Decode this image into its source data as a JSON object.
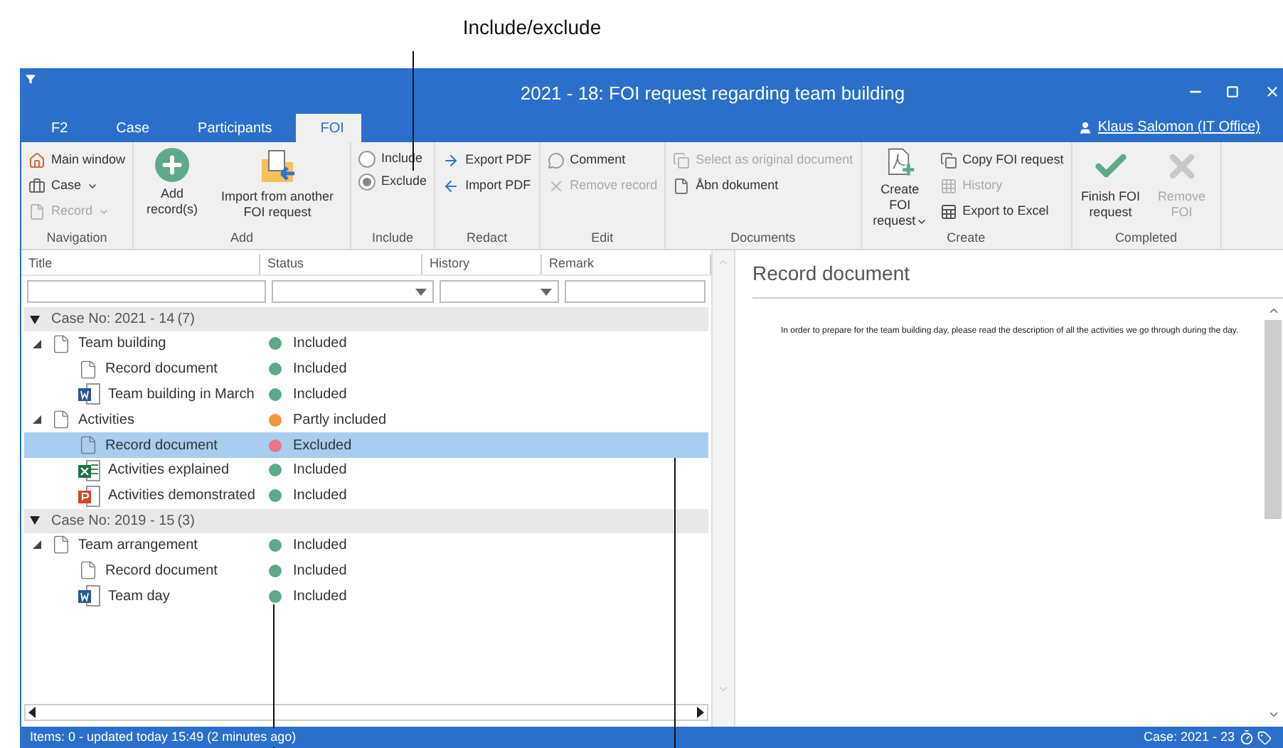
{
  "callout": {
    "label": "Include/exclude"
  },
  "window": {
    "title": "2021 - 18: FOI request regarding team building",
    "user": "Klaus Salomon (IT Office)"
  },
  "tabs": [
    {
      "label": "F2",
      "selected": false
    },
    {
      "label": "Case",
      "selected": false
    },
    {
      "label": "Participants",
      "selected": false
    },
    {
      "label": "FOI",
      "selected": true
    }
  ],
  "ribbon": [
    {
      "label": "Navigation",
      "items": [
        {
          "kind": "small",
          "label": "Main window",
          "disabled": false
        },
        {
          "kind": "small",
          "label": "Case",
          "caret": true,
          "disabled": false
        },
        {
          "kind": "small",
          "label": "Record",
          "caret": true,
          "disabled": true
        }
      ]
    },
    {
      "label": "Add",
      "items": [
        {
          "kind": "large",
          "label": "Add record(s)",
          "disabled": false
        },
        {
          "kind": "large",
          "label": "Import from another FOI request",
          "disabled": false
        }
      ]
    },
    {
      "label": "Include",
      "items": [
        {
          "kind": "radio",
          "label": "Include",
          "selected": false
        },
        {
          "kind": "radio",
          "label": "Exclude",
          "selected": true
        }
      ]
    },
    {
      "label": "Redact",
      "items": [
        {
          "kind": "small",
          "label": "Export PDF",
          "disabled": false
        },
        {
          "kind": "small",
          "label": "Import PDF",
          "disabled": false
        }
      ]
    },
    {
      "label": "Edit",
      "items": [
        {
          "kind": "small",
          "label": "Comment",
          "disabled": false
        },
        {
          "kind": "small",
          "label": "Remove record",
          "disabled": true
        }
      ]
    },
    {
      "label": "Documents",
      "items": [
        {
          "kind": "small",
          "label": "Select as original document",
          "disabled": true
        },
        {
          "kind": "small",
          "label": "Åbn dokument",
          "disabled": false
        }
      ]
    },
    {
      "label": "Create",
      "items": [
        {
          "kind": "large",
          "label": "Create FOI request",
          "caret": true,
          "disabled": false
        },
        {
          "kind": "small",
          "label": "Copy FOI request",
          "disabled": false
        },
        {
          "kind": "small",
          "label": "History",
          "disabled": true
        },
        {
          "kind": "small",
          "label": "Export to Excel",
          "disabled": false
        }
      ]
    },
    {
      "label": "Completed",
      "items": [
        {
          "kind": "large",
          "label": "Finish FOI request",
          "disabled": false
        },
        {
          "kind": "large",
          "label": "Remove FOI",
          "disabled": true
        }
      ]
    }
  ],
  "table": {
    "columns": [
      {
        "label": "Title",
        "kind": "text"
      },
      {
        "label": "Status",
        "kind": "dropdown"
      },
      {
        "label": "History",
        "kind": "dropdown"
      },
      {
        "label": "Remark",
        "kind": "text"
      }
    ],
    "groups": [
      {
        "label": "Case No: 2021 - 14",
        "count": "(7)",
        "expanded": true,
        "rows": [
          {
            "title": "Team building",
            "kind": "doc",
            "status": "Included",
            "color": "#5fa98a",
            "selected": false,
            "expanded": true,
            "children": [
              {
                "title": "Record document",
                "kind": "doc",
                "status": "Included",
                "color": "#5fa98a",
                "selected": false
              },
              {
                "title": "Team building in March",
                "kind": "word",
                "status": "Included",
                "color": "#5fa98a",
                "selected": false
              }
            ]
          },
          {
            "title": "Activities",
            "kind": "doc",
            "status": "Partly included",
            "color": "#f0973c",
            "selected": false,
            "expanded": true,
            "children": [
              {
                "title": "Record document",
                "kind": "doc",
                "status": "Excluded",
                "color": "#e8758a",
                "selected": true
              },
              {
                "title": "Activities explained",
                "kind": "excel",
                "status": "Included",
                "color": "#5fa98a",
                "selected": false
              },
              {
                "title": "Activities demonstrated",
                "kind": "powerpoint",
                "status": "Included",
                "color": "#5fa98a",
                "selected": false
              }
            ]
          }
        ]
      },
      {
        "label": "Case No: 2019 - 15",
        "count": "(3)",
        "expanded": true,
        "rows": [
          {
            "title": "Team arrangement",
            "kind": "doc",
            "status": "Included",
            "color": "#5fa98a",
            "selected": false,
            "expanded": true,
            "children": [
              {
                "title": "Record document",
                "kind": "doc",
                "status": "Included",
                "color": "#5fa98a",
                "selected": false
              },
              {
                "title": "Team day",
                "kind": "word",
                "status": "Included",
                "color": "#5fa98a",
                "selected": false
              }
            ]
          }
        ]
      }
    ]
  },
  "preview": {
    "title": "Record document",
    "text": "In order to prepare for the team building day, please read the description of all the activities we go through during the day."
  },
  "status_bar": {
    "left": "Items: 0 - updated today 15:49 (2 minutes ago)",
    "right": "Case: 2021 - 23"
  }
}
